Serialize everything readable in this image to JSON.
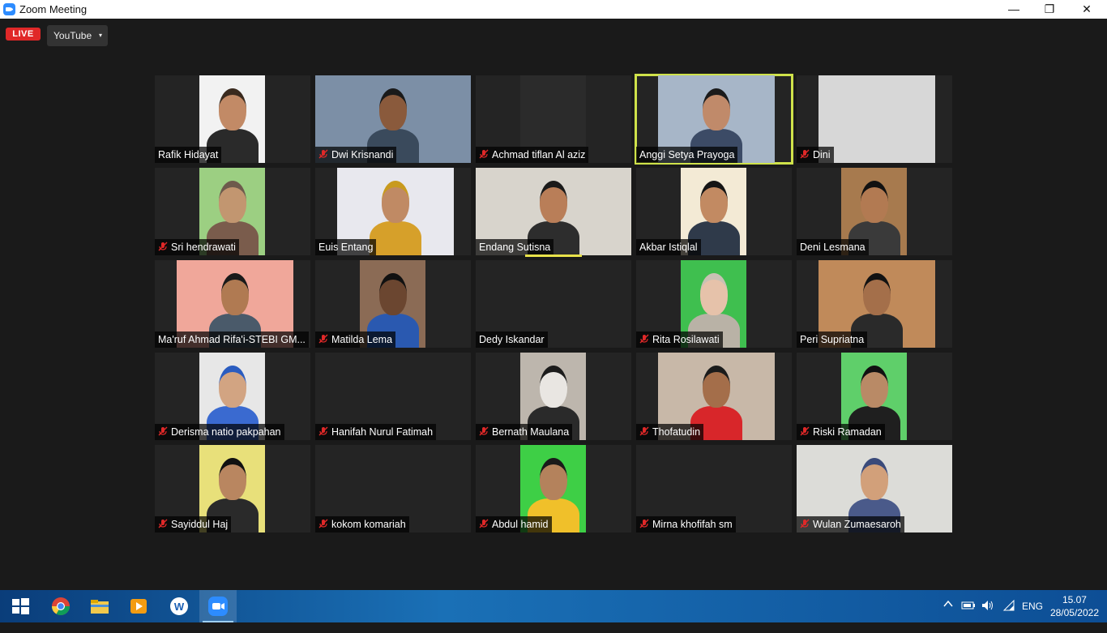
{
  "window": {
    "title": "Zoom Meeting",
    "minimize": "—",
    "restore": "❐",
    "close": "✕"
  },
  "topbar": {
    "live_label": "LIVE",
    "stream_target": "YouTube",
    "caret": "▾"
  },
  "participants": [
    {
      "name": "Rafik Hidayat",
      "muted": false
    },
    {
      "name": "Dwi Krisnandi",
      "muted": true
    },
    {
      "name": "Achmad tiflan Al aziz",
      "muted": true
    },
    {
      "name": "Anggi Setya Prayoga",
      "muted": false,
      "active_speaker": true
    },
    {
      "name": "Dini",
      "muted": true
    },
    {
      "name": "Sri hendrawati",
      "muted": true
    },
    {
      "name": "Euis Entang",
      "muted": false
    },
    {
      "name": "Endang Sutisna",
      "muted": false
    },
    {
      "name": "Akbar Istiqlal",
      "muted": false
    },
    {
      "name": "Deni Lesmana",
      "muted": false
    },
    {
      "name": "Ma'ruf Ahmad Rifa'i-STEBI GM...",
      "muted": false
    },
    {
      "name": "Matilda Lema",
      "muted": true
    },
    {
      "name": "Dedy Iskandar",
      "muted": false
    },
    {
      "name": "Rita Rosilawati",
      "muted": true
    },
    {
      "name": "Peri Supriatna",
      "muted": false
    },
    {
      "name": "Derisma natio pakpahan",
      "muted": true
    },
    {
      "name": "Hanifah Nurul Fatimah",
      "muted": true
    },
    {
      "name": "Bernath Maulana",
      "muted": true
    },
    {
      "name": "Thofatudin",
      "muted": true
    },
    {
      "name": "Riski Ramadan",
      "muted": true
    },
    {
      "name": "Sayiddul Haj",
      "muted": true
    },
    {
      "name": "kokom komariah",
      "muted": true
    },
    {
      "name": "Abdul hamid",
      "muted": true
    },
    {
      "name": "Mirna khofifah sm",
      "muted": true
    },
    {
      "name": "Wulan Zumaesaroh",
      "muted": true
    }
  ],
  "taskbar": {
    "apps": [
      "start-icon",
      "chrome-icon",
      "file-explorer-icon",
      "media-player-icon",
      "wps-writer-icon",
      "zoom-icon"
    ],
    "language": "ENG",
    "time": "15.07",
    "date": "28/05/2022"
  },
  "colors": {
    "accent_active": "#cfe24a",
    "live_red": "#e02828",
    "muted_red": "#e02828"
  }
}
